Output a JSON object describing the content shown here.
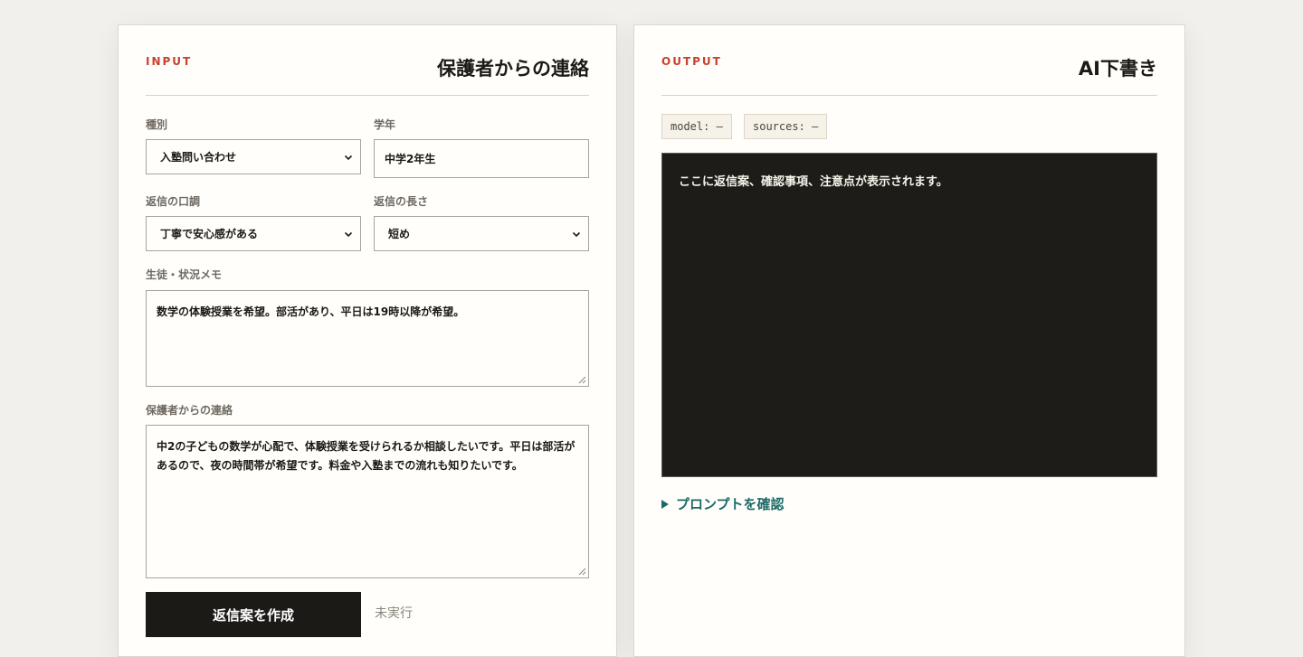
{
  "input_panel": {
    "kicker": "INPUT",
    "title": "保護者からの連絡",
    "fields": {
      "type": {
        "label": "種別",
        "value": "入塾問い合わせ"
      },
      "grade": {
        "label": "学年",
        "value": "中学2年生"
      },
      "tone": {
        "label": "返信の口調",
        "value": "丁寧で安心感がある"
      },
      "length": {
        "label": "返信の長さ",
        "value": "短め"
      },
      "memo": {
        "label": "生徒・状況メモ",
        "value": "数学の体験授業を希望。部活があり、平日は19時以降が希望。"
      },
      "message": {
        "label": "保護者からの連絡",
        "value": "中2の子どもの数学が心配で、体験授業を受けられるか相談したいです。平日は部活があるので、夜の時間帯が希望です。料金や入塾までの流れも知りたいです。"
      }
    },
    "submit_label": "返信案を作成",
    "status": "未実行"
  },
  "output_panel": {
    "kicker": "OUTPUT",
    "title": "AI下書き",
    "model_chip": "model: —",
    "sources_chip": "sources: —",
    "placeholder": "ここに返信案、確認事項、注意点が表示されます。",
    "details_label": "プロンプトを確認"
  },
  "colors": {
    "accent_red": "#c8402c",
    "teal": "#1c6a66",
    "dark": "#1c1a17",
    "background": "#f2f0ec"
  }
}
